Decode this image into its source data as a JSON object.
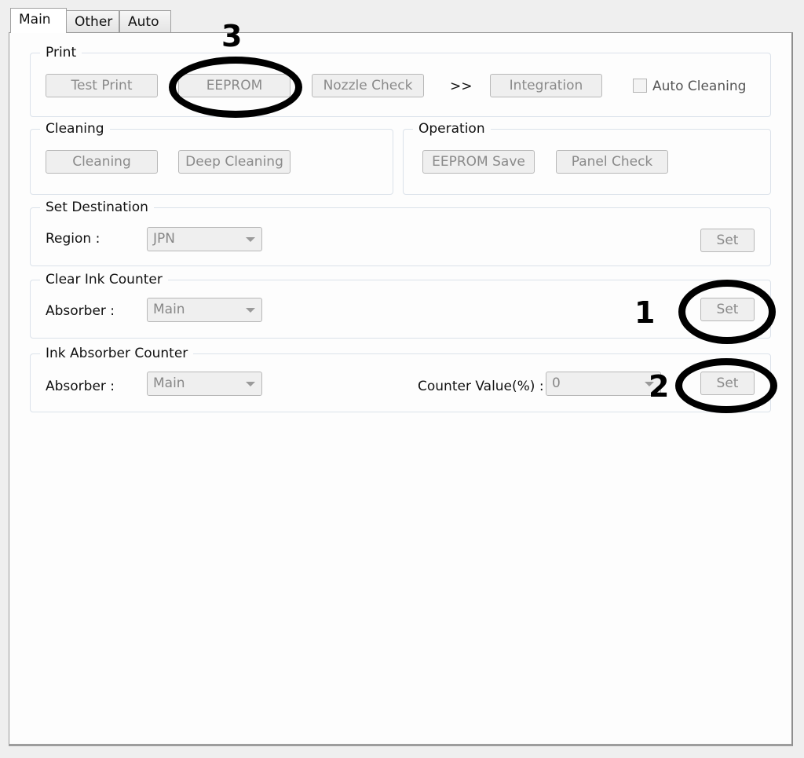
{
  "tabs": [
    {
      "label": "Main",
      "active": true
    },
    {
      "label": "Other",
      "active": false
    },
    {
      "label": "Auto",
      "active": false
    }
  ],
  "print": {
    "title": "Print",
    "buttons": [
      "Test Print",
      "EEPROM",
      "Nozzle Check",
      "Integration"
    ],
    "separator": ">>",
    "auto_cleaning_label": "Auto Cleaning",
    "auto_cleaning_checked": false
  },
  "cleaning": {
    "title": "Cleaning",
    "buttons": [
      "Cleaning",
      "Deep Cleaning"
    ]
  },
  "operation": {
    "title": "Operation",
    "buttons": [
      "EEPROM Save",
      "Panel Check"
    ]
  },
  "set_destination": {
    "title": "Set Destination",
    "region_label": "Region :",
    "region_value": "JPN",
    "set_label": "Set"
  },
  "clear_ink_counter": {
    "title": "Clear Ink Counter",
    "absorber_label": "Absorber :",
    "absorber_value": "Main",
    "set_label": "Set"
  },
  "ink_absorber_counter": {
    "title": "Ink Absorber Counter",
    "absorber_label": "Absorber :",
    "absorber_value": "Main",
    "counter_label": "Counter Value(%) :",
    "counter_value": "0",
    "set_label": "Set"
  },
  "annotations": [
    {
      "number": "1",
      "target": "clear-ink-counter-set"
    },
    {
      "number": "2",
      "target": "ink-absorber-counter-set"
    },
    {
      "number": "3",
      "target": "eeprom-button"
    }
  ]
}
